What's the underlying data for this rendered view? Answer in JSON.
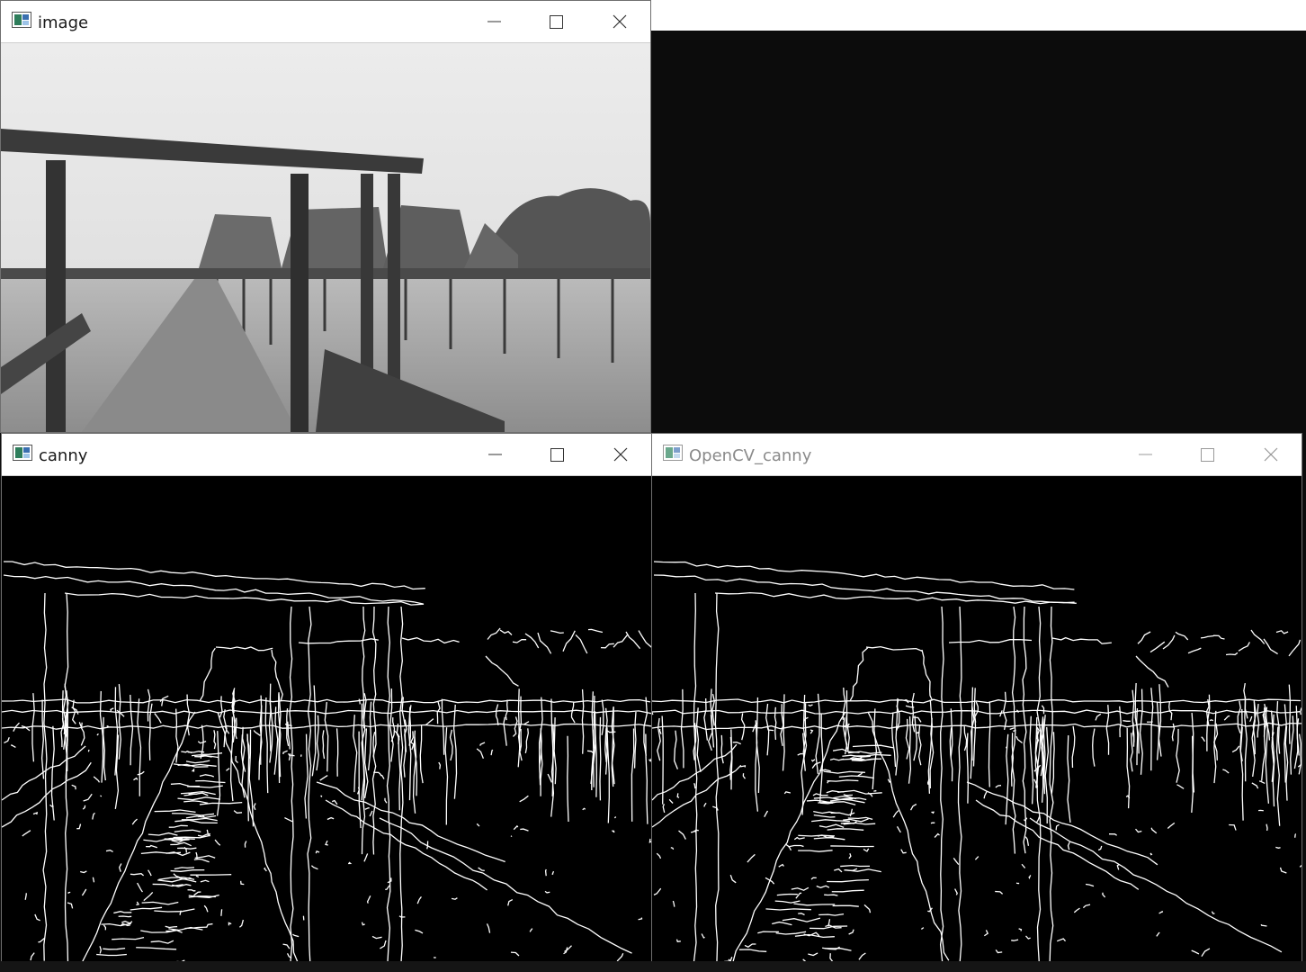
{
  "windows": {
    "image": {
      "title": "image"
    },
    "canny": {
      "title": "canny"
    },
    "opencv_canny": {
      "title": "OpenCV_canny"
    }
  },
  "controls": {
    "minimize": "minimize-icon",
    "maximize": "maximize-icon",
    "close": "close-icon"
  },
  "colors": {
    "titlebar": "#ffffff",
    "edge": "#ffffff",
    "canvas": "#000000",
    "desktop": "#0c0c0c"
  }
}
